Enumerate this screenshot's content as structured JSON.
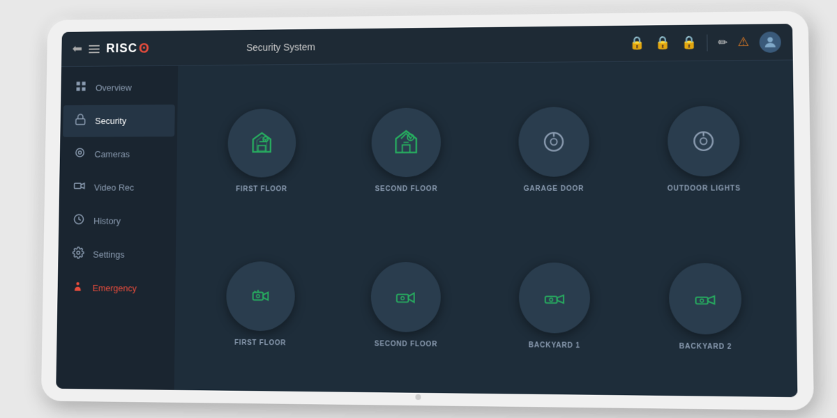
{
  "header": {
    "back_label": "←",
    "logo_text": "RISC",
    "title": "Security System",
    "edit_icon": "✏",
    "alert_icon": "⚠"
  },
  "sidebar": {
    "items": [
      {
        "id": "overview",
        "label": "Overview",
        "icon": "grid",
        "active": false
      },
      {
        "id": "security",
        "label": "Security",
        "icon": "lock",
        "active": true
      },
      {
        "id": "cameras",
        "label": "Cameras",
        "icon": "camera",
        "active": false
      },
      {
        "id": "videorec",
        "label": "Video Rec",
        "icon": "video",
        "active": false
      },
      {
        "id": "history",
        "label": "History",
        "icon": "clock",
        "active": false
      },
      {
        "id": "settings",
        "label": "Settings",
        "icon": "gear",
        "active": false
      },
      {
        "id": "emergency",
        "label": "Emergency",
        "icon": "alert-person",
        "active": false
      }
    ]
  },
  "zones": {
    "row1": [
      {
        "id": "first-floor-security",
        "label": "FIRST FLOOR",
        "type": "home-armed"
      },
      {
        "id": "second-floor-security",
        "label": "SECOND FLOOR",
        "type": "home-armed"
      },
      {
        "id": "garage-door",
        "label": "GARAGE DOOR",
        "type": "power"
      },
      {
        "id": "outdoor-lights",
        "label": "OUTDOOR LIGHTS",
        "type": "power"
      }
    ],
    "row2": [
      {
        "id": "first-floor-camera",
        "label": "FIRST FLOOR",
        "type": "remote"
      },
      {
        "id": "second-floor-camera",
        "label": "SECOND FLOOR",
        "type": "camera-zone"
      },
      {
        "id": "backyard1",
        "label": "BACKYARD 1",
        "type": "camera-zone"
      },
      {
        "id": "backyard2",
        "label": "BACKYARD 2",
        "type": "camera-zone"
      }
    ]
  },
  "colors": {
    "accent_green": "#27ae60",
    "accent_orange": "#e67e22",
    "accent_red": "#e74c3c",
    "sidebar_bg": "#1a2530",
    "content_bg": "#1e2d3a",
    "circle_bg": "#2a3d4e",
    "text_secondary": "#8a9bb0"
  }
}
